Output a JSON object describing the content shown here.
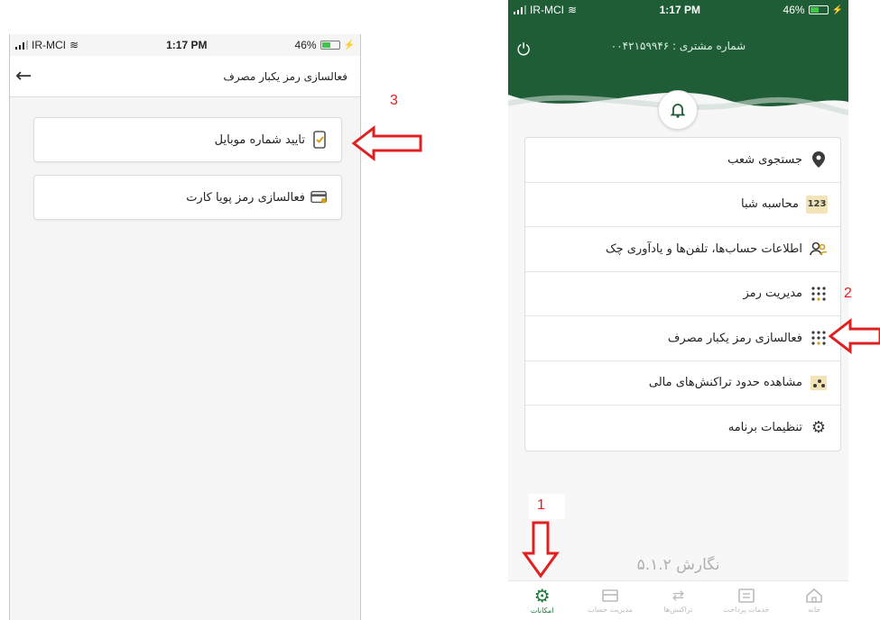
{
  "left_screen": {
    "status": {
      "carrier": "IR-MCI",
      "time": "1:17 PM",
      "battery": "46%"
    },
    "header_title": "فعالسازی رمز یکبار مصرف",
    "cards": [
      {
        "label": "تایید شماره موبایل",
        "icon": "phone-check-icon"
      },
      {
        "label": "فعالسازی رمز پویا کارت",
        "icon": "card-key-icon"
      }
    ]
  },
  "right_screen": {
    "status": {
      "carrier": "IR-MCI",
      "time": "1:17 PM",
      "battery": "46%"
    },
    "customer_number": "شماره مشتری : ۰۰۴۲۱۵۹۹۴۶",
    "menu": [
      {
        "label": "جستجوی شعب",
        "icon": "location-pin-icon"
      },
      {
        "label": "محاسبه شبا",
        "icon": "numbers-123-icon"
      },
      {
        "label": "اطلاعات حساب‌ها، تلفن‌ها و یادآوری چک",
        "icon": "contacts-icon"
      },
      {
        "label": "مدیریت رمز",
        "icon": "keypad-icon"
      },
      {
        "label": "فعالسازی رمز یکبار مصرف",
        "icon": "keypad-icon"
      },
      {
        "label": "مشاهده حدود تراکنش‌های مالی",
        "icon": "chart-dots-icon"
      },
      {
        "label": "تنظیمات برنامه",
        "icon": "gear-icon"
      }
    ],
    "version": "نگارش ۵.۱.۲",
    "tabs": [
      {
        "label": "امکانات",
        "icon": "gear-icon",
        "active": true
      },
      {
        "label": "مدیریت حساب",
        "icon": "wallet-icon",
        "active": false
      },
      {
        "label": "تراکنش‌ها",
        "icon": "transfer-icon",
        "active": false
      },
      {
        "label": "خدمات پرداخت",
        "icon": "payment-icon",
        "active": false
      },
      {
        "label": "خانه",
        "icon": "home-icon",
        "active": false
      }
    ]
  },
  "annotations": {
    "step1": "1",
    "step2": "2",
    "step3": "3"
  },
  "colors": {
    "header_green": "#1f5d37",
    "accent_red": "#e02020",
    "active_tab": "#1f7a3c"
  }
}
